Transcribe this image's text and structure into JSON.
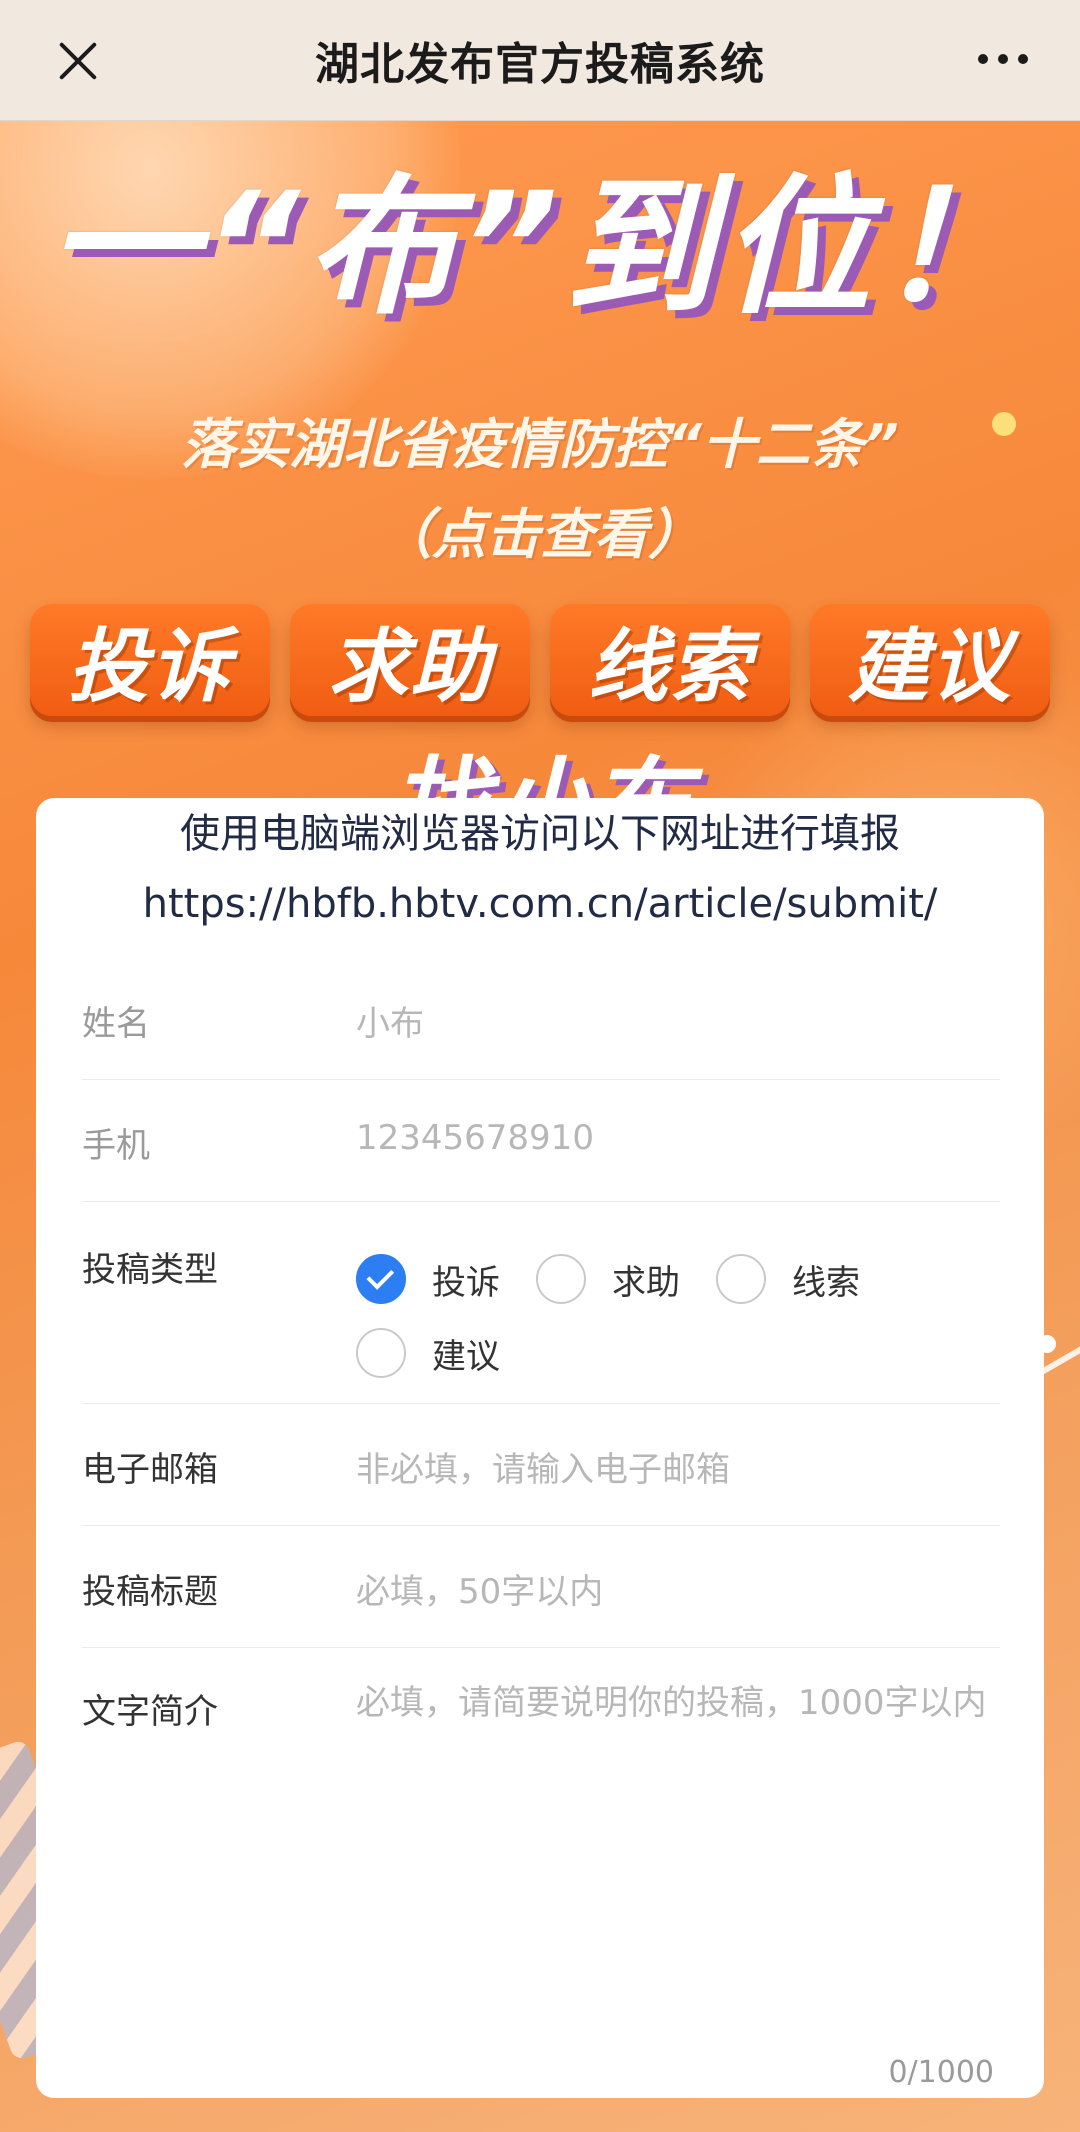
{
  "navbar": {
    "title": "湖北发布官方投稿系统"
  },
  "banner": {
    "slogan": "一“布”到位！",
    "subtitle_line1": "落实湖北省疫情防控“十二条”",
    "subtitle_line2": "（点击查看）",
    "tags": [
      "投诉",
      "求助",
      "线索",
      "建议"
    ],
    "find": "找小布"
  },
  "form": {
    "notice": "使用电脑端浏览器访问以下网址进行填报",
    "url": "https://hbfb.hbtv.com.cn/article/submit/",
    "name": {
      "label": "姓名",
      "placeholder": "小布"
    },
    "phone": {
      "label": "手机",
      "placeholder": "12345678910"
    },
    "type": {
      "label": "投稿类型",
      "options": [
        "投诉",
        "求助",
        "线索",
        "建议"
      ],
      "selected": "投诉"
    },
    "email": {
      "label": "电子邮箱",
      "placeholder": "非必填，请输入电子邮箱"
    },
    "title": {
      "label": "投稿标题",
      "placeholder": "必填，50字以内"
    },
    "summary": {
      "label": "文字简介",
      "placeholder": "必填，请简要说明你的投稿，1000字以内",
      "counter": "0/1000"
    }
  },
  "colors": {
    "accent": "#2c7ef2",
    "banner": "#f6883a"
  }
}
